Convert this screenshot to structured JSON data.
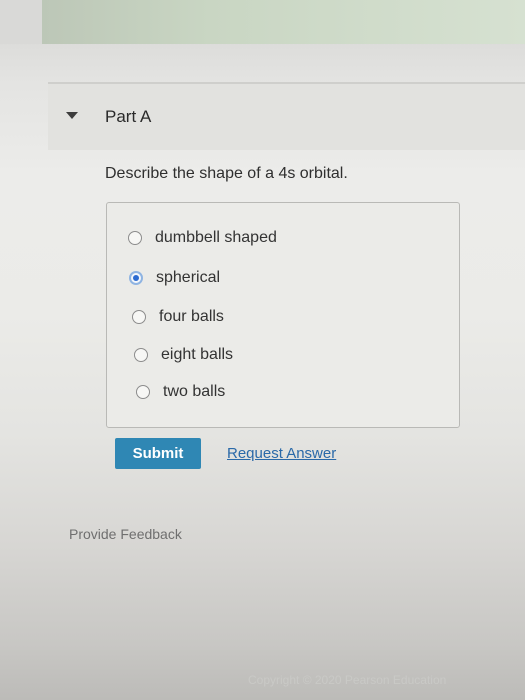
{
  "part": {
    "title": "Part A",
    "question": "Describe the shape of a 4s orbital."
  },
  "options": [
    {
      "label": "dumbbell shaped",
      "selected": false
    },
    {
      "label": "spherical",
      "selected": true
    },
    {
      "label": "four balls",
      "selected": false
    },
    {
      "label": "eight balls",
      "selected": false
    },
    {
      "label": "two balls",
      "selected": false
    }
  ],
  "actions": {
    "submit_label": "Submit",
    "request_answer_label": "Request Answer"
  },
  "footer": {
    "feedback_label": "Provide Feedback",
    "copyright": "Copyright © 2020 Pearson Education"
  },
  "colors": {
    "submit_button": "#2f87b4",
    "link": "#2a69a8",
    "selected_radio": "#2c6bd1"
  }
}
